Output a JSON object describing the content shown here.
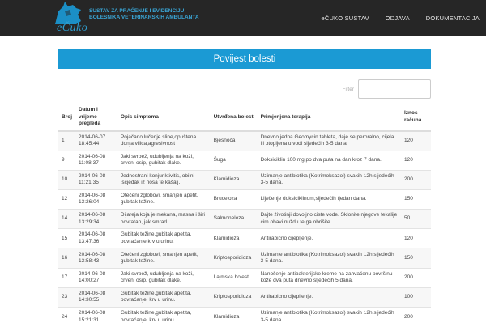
{
  "app": {
    "logo_text": "eČuko",
    "subtitle": "SUSTAV ZA PRAĆENJE I EVIDENCIJU BOLESNIKA VETERINARSKIH AMBULANTA"
  },
  "nav": {
    "items": [
      "eČUKO SUSTAV",
      "ODJAVA",
      "DOKUMENTACIJA"
    ]
  },
  "panel": {
    "title": "Povijest bolesti"
  },
  "filter": {
    "label": "Filter",
    "value": ""
  },
  "table": {
    "headers": {
      "no": "Broj",
      "datetime": "Datum i vrijeme pregleda",
      "symptoms": "Opis simptoma",
      "disease": "Utvrđena bolest",
      "therapy": "Primjenjena terapija",
      "amount": "Iznos računa"
    },
    "rows": [
      {
        "no": "1",
        "datetime": "2014-06-07 18:45:44",
        "symptoms": "Pojačano lučenje sline,opuštena donja vilica,agresivnost",
        "disease": "Bjesnoća",
        "therapy": "Dnevno jedna Geomycin tableta, daje se peroralno, cijela ili otopljena u vodi sljedećih 3-5 dana.",
        "amount": "120"
      },
      {
        "no": "9",
        "datetime": "2014-06-08 11:08:37",
        "symptoms": "Jaki svrbež, udubljenja na koži, crveni osip, gubitak dlake.",
        "disease": "Šuga",
        "therapy": "Doksiciklin 100 mg po dva puta na dan kroz 7 dana.",
        "amount": "120"
      },
      {
        "no": "10",
        "datetime": "2014-06-08 11:21:35",
        "symptoms": "Jednostrani konjunktivitis, obilni iscjedak iz nosa te kašalj.",
        "disease": "Klamidioza",
        "therapy": "Uzimanje antibiotika (Kotrimoksazol) svakih 12h sljedećih 3-5 dana.",
        "amount": "200"
      },
      {
        "no": "12",
        "datetime": "2014-06-08 13:26:04",
        "symptoms": "Otečeni zglobovi, smanjen apetit, gubitak težine.",
        "disease": "Bruceloza",
        "therapy": "Liječenje doksiciklinom,sljedećih tjedan dana.",
        "amount": "150"
      },
      {
        "no": "14",
        "datetime": "2014-06-08 13:29:34",
        "symptoms": "Dijareja koja je mekana, masna i širi odvratan, jak smrad.",
        "disease": "Salmoneloza",
        "therapy": "Dajte životinji dovoljno ciste vode. Sklonite njegove fekalije cim obavi nuždu te ga obrišite.",
        "amount": "50"
      },
      {
        "no": "15",
        "datetime": "2014-06-08 13:47:36",
        "symptoms": "Gubitak težine,gubitak apetita, povraćanje krv u urinu.",
        "disease": "Klamidioza",
        "therapy": "Antirabicno cijepljenje.",
        "amount": "120"
      },
      {
        "no": "16",
        "datetime": "2014-06-08 13:58:43",
        "symptoms": "Otečeni zglobovi, smanjen apetit, gubitak težine.",
        "disease": "Kriptosporidioza",
        "therapy": "Uzimanje antibiotika (Kotrimoksazol) svakih 12h sljedećih 3-5 dana.",
        "amount": "150"
      },
      {
        "no": "17",
        "datetime": "2014-06-08 14:00:27",
        "symptoms": "Jaki svrbež, udubljenja na koži, crveni osip, gubitak dlake.",
        "disease": "Lajmska bolest",
        "therapy": "Nanošenje antibakterijske kreme na zahvaćenu površinu kože dva puta dnevno sljedećih 5 dana.",
        "amount": "200"
      },
      {
        "no": "23",
        "datetime": "2014-06-08 14:30:55",
        "symptoms": "Gubitak težine,gubitak apetita, povraćanje, krv u urinu.",
        "disease": "Kriptosporidioza",
        "therapy": "Antirabicno cijepljenje.",
        "amount": "100"
      },
      {
        "no": "24",
        "datetime": "2014-06-08 15:21:31",
        "symptoms": "Gubitak težine,gubitak apetita, povraćanje, krv u urinu.",
        "disease": "Klamidioza",
        "therapy": "Uzimanje antibiotika (Kotrimoksazol) svakih 12h sljedećih 3-5 dana.",
        "amount": "200"
      }
    ]
  },
  "colors": {
    "navbar": "#262626",
    "accent": "#1b9ad4"
  }
}
